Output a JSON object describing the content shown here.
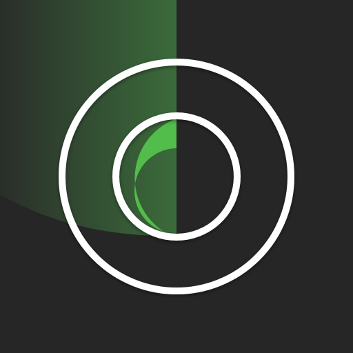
{
  "icon": {
    "name": "radar-scanner-icon",
    "colors": {
      "background": "#262626",
      "sweep_light": "#3b6b3b",
      "sweep_dark": "#2a2e2a",
      "blip": "#52bd4a",
      "ring": "#ffffff"
    }
  }
}
